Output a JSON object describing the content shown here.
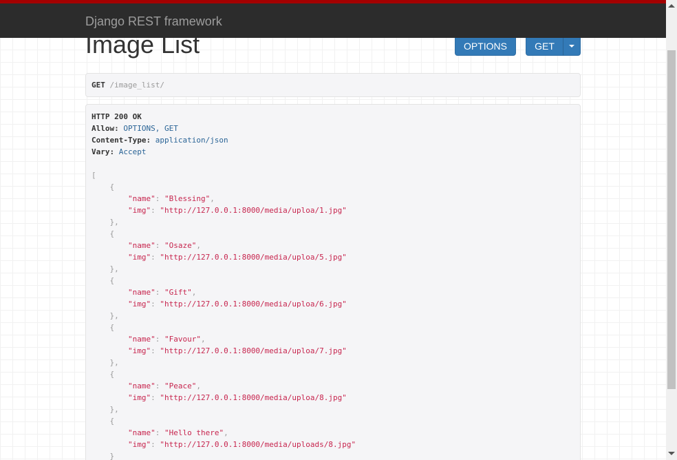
{
  "navbar": {
    "brand": "Django REST framework"
  },
  "page": {
    "title": "Image List"
  },
  "buttons": {
    "options": "OPTIONS",
    "get": "GET"
  },
  "request": {
    "method": "GET",
    "path": "/image_list/"
  },
  "response": {
    "status": "HTTP 200 OK",
    "headers": [
      {
        "key": "Allow:",
        "value": "OPTIONS, GET"
      },
      {
        "key": "Content-Type:",
        "value": "application/json"
      },
      {
        "key": "Vary:",
        "value": "Accept"
      }
    ],
    "items": [
      {
        "name": "Blessing",
        "img": "http://127.0.0.1:8000/media/uploa/1.jpg"
      },
      {
        "name": "Osaze",
        "img": "http://127.0.0.1:8000/media/uploa/5.jpg"
      },
      {
        "name": "Gift",
        "img": "http://127.0.0.1:8000/media/uploa/6.jpg"
      },
      {
        "name": "Favour",
        "img": "http://127.0.0.1:8000/media/uploa/7.jpg"
      },
      {
        "name": "Peace",
        "img": "http://127.0.0.1:8000/media/uploa/8.jpg"
      },
      {
        "name": "Hello there",
        "img": "http://127.0.0.1:8000/media/uploads/8.jpg"
      }
    ]
  },
  "colors": {
    "navbar": "#2c2c2c",
    "accent_stripe": "#a30000",
    "button": "#337ab7",
    "string": "#c7254e"
  }
}
